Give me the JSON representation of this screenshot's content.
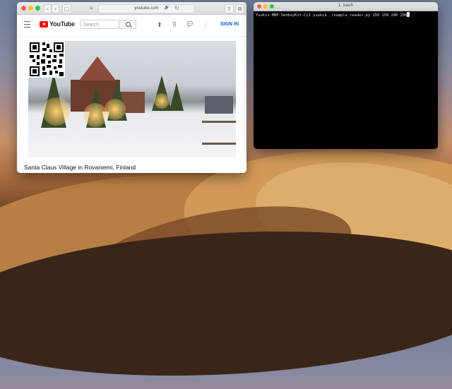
{
  "browser": {
    "url": "youtube.com",
    "logo_text": "YouTube",
    "search_placeholder": "Search",
    "sign_in_label": "SIGN IN",
    "video_title": "Santa Claus Village in Rovaniemi, Finland",
    "toolbar_glyphs": {
      "back": "‹",
      "forward": "›",
      "sidebar": "▢",
      "reader": "≡",
      "volume": "🔊",
      "reload": "↻",
      "share": "⇪",
      "tabs": "⧉"
    },
    "header_glyphs": {
      "upload": "⬆",
      "apps": "⠿",
      "messages": "💬",
      "more": "⋮"
    }
  },
  "terminal": {
    "title": "1. bash",
    "prompt": "Yuukis-MBP:SenboyKit-CLI yuuki$ ",
    "command": "./sample_reader.py 150 150 200 200"
  },
  "colors": {
    "accent": "#065fd4",
    "youtube_red": "#ff0000",
    "terminal_bg": "#000000"
  }
}
